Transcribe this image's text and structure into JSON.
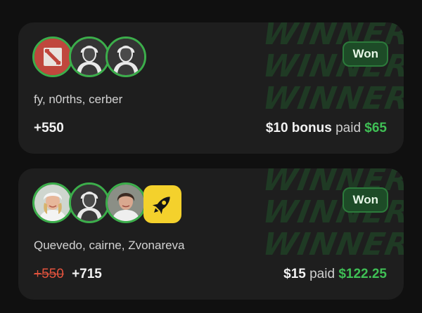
{
  "cards": [
    {
      "badge": "Won",
      "watermark": [
        "WINNER!!",
        "WINNER!!",
        "WINNER!!"
      ],
      "players": "fy, n0rths, cerber",
      "odds": "+550",
      "stake": "$10 bonus",
      "paid_label": "paid",
      "paid_amount": "$65",
      "avatars": [
        "dota2-icon",
        "player-silhouette-icon",
        "player-silhouette-icon"
      ]
    },
    {
      "badge": "Won",
      "watermark": [
        "WINNER!!",
        "WINNER!!",
        "WINNER!!"
      ],
      "players": "Quevedo, cairne, Zvonareva",
      "old_odds": "+550",
      "odds": "+715",
      "stake": "$15",
      "paid_label": "paid",
      "paid_amount": "$122.25",
      "avatars": [
        "player-photo-blonde",
        "player-silhouette-icon",
        "player-photo-brunette",
        "rocket-boost-icon"
      ]
    }
  ],
  "colors": {
    "accent_green": "#3fbf55",
    "ring_green": "#3cae4b",
    "strike_red": "#e4533d",
    "boost_yellow": "#f4d12c"
  }
}
